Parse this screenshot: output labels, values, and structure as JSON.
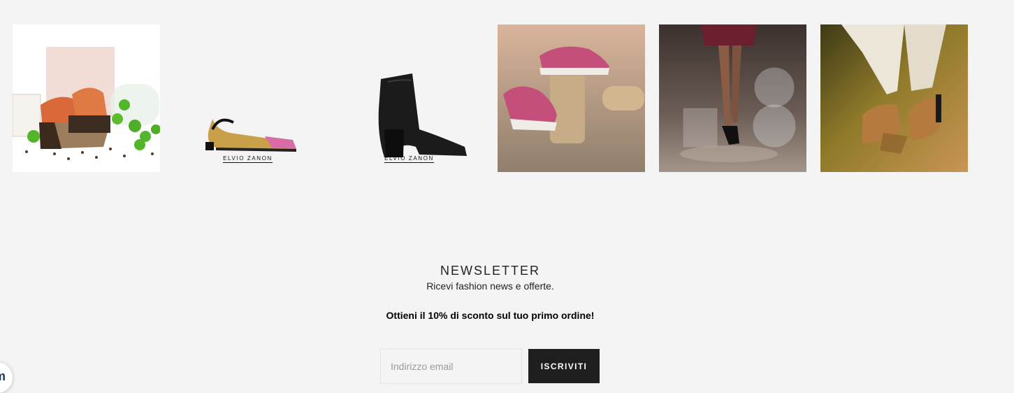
{
  "gallery": {
    "brand_label": "ELVIO ZANON",
    "items": [
      {
        "icon": "sandal-packshot-image"
      },
      {
        "icon": "snakeskin-slingback-image"
      },
      {
        "icon": "black-ankle-boot-image"
      },
      {
        "icon": "pink-sneakers-image"
      },
      {
        "icon": "model-legs-glass-image"
      },
      {
        "icon": "tan-mule-image"
      }
    ]
  },
  "newsletter": {
    "title": "NEWSLETTER",
    "subtitle": "Ricevi fashion news e offerte.",
    "offer": "Ottieni il 10% di sconto sul tuo primo ordine!",
    "email_placeholder": "Indirizzo email",
    "submit_label": "ISCRIVITI"
  },
  "chat": {
    "icon": "chat-bubble-icon",
    "glyph": "m"
  },
  "colors": {
    "background": "#f4f4f4",
    "button": "#1f1f1f"
  }
}
